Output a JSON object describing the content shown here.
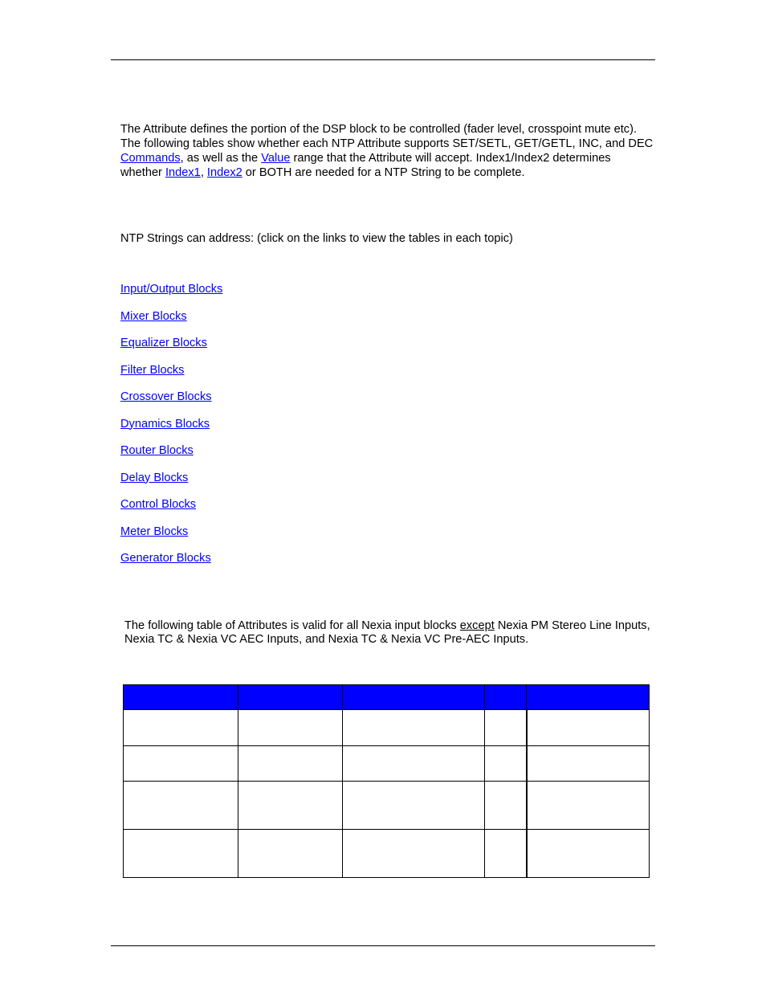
{
  "intro": {
    "part1": "The Attribute defines the portion of the DSP block to be controlled (fader level, crosspoint mute etc). The following tables show whether each NTP Attribute supports SET/SETL, GET/GETL, INC, and DEC ",
    "commands_link": "Commands",
    "part2": ", as well as the ",
    "value_link": "Value",
    "part3": " range that the Attribute will accept. Index1/Index2 determines whether ",
    "index1_link": "Index1",
    "sep": ", ",
    "index2_link": "Index2",
    "part4": " or BOTH are needed for a NTP String to be complete."
  },
  "address_text": "NTP Strings can address: (click on the links to view the tables in each topic)",
  "block_links": [
    "Input/Output Blocks",
    "Mixer Blocks",
    "Equalizer Blocks",
    "Filter Blocks",
    "Crossover Blocks",
    "Dynamics Blocks",
    "Router Blocks",
    "Delay Blocks",
    "Control Blocks",
    "Meter Blocks",
    "Generator Blocks"
  ],
  "table_note": {
    "part1": "The following table of Attributes is valid for all Nexia input blocks ",
    "emphasis": "except",
    "part2": " Nexia PM Stereo Line Inputs, Nexia TC & Nexia VC AEC Inputs, and Nexia TC & Nexia VC Pre-AEC Inputs."
  },
  "table": {
    "header_color": "#0000ff",
    "headers": [
      "",
      "",
      "",
      "",
      ""
    ],
    "rows": [
      [
        "",
        "",
        "",
        "",
        ""
      ],
      [
        "",
        "",
        "",
        "",
        ""
      ],
      [
        "",
        "",
        "",
        "",
        ""
      ],
      [
        "",
        "",
        "",
        "",
        ""
      ]
    ]
  },
  "colors": {
    "link": "#0000ff"
  }
}
